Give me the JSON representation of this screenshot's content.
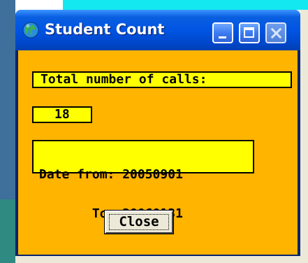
{
  "window": {
    "title": "Student Count",
    "icon": "globe-icon"
  },
  "title_buttons": {
    "minimize": "minimize-icon",
    "maximize": "maximize-icon",
    "close": "close-icon"
  },
  "content": {
    "calls_label": "Total number of calls:",
    "calls_count": "18",
    "date_from": "Date from: 20050901",
    "date_to": "       To: 20060131"
  },
  "actions": {
    "close_label": "Close"
  },
  "colors": {
    "client_background": "#ffb400",
    "label_background": "#ffff00",
    "titlebar": "#0054e3"
  }
}
